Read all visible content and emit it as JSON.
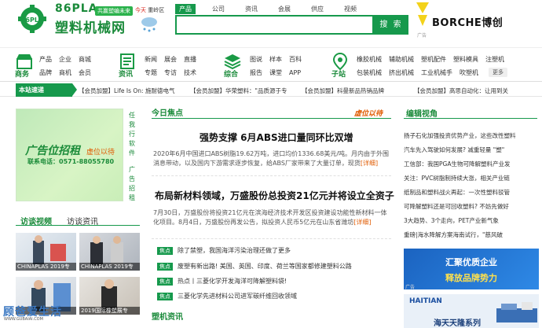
{
  "header": {
    "logo_en": "86PLA",
    "logo_slogan": "共赢塑编未来",
    "logo_cn": "塑料机械网",
    "city_label": "今天",
    "city_name": "重岭区",
    "search_tabs": [
      "产品",
      "公司",
      "资讯",
      "会展",
      "供应",
      "视频"
    ],
    "search_active": "产品",
    "search_placeholder": "",
    "search_button": "搜 索",
    "ad_brand": "BORCHE博创",
    "ad_tag": "广告"
  },
  "nav": [
    {
      "title": "商务",
      "icon": "store-icon",
      "row1": [
        "产品",
        "企业",
        "商城"
      ],
      "row2": [
        "品牌",
        "商机",
        "会员"
      ]
    },
    {
      "title": "资讯",
      "icon": "news-icon",
      "row1": [
        "新闻",
        "展会",
        "直播"
      ],
      "row2": [
        "专题",
        "专访",
        "技术"
      ]
    },
    {
      "title": "综合",
      "icon": "layers-icon",
      "row1": [
        "图说",
        "样本",
        "百科"
      ],
      "row2": [
        "报告",
        "课堂",
        "APP"
      ]
    },
    {
      "title": "子站",
      "icon": "location-icon",
      "row1": [
        "橡胶机械",
        "辅助机械",
        "塑机配件",
        "塑料模具",
        "注塑机"
      ],
      "row2": [
        "包装机械",
        "挤出机械",
        "工业机械手",
        "吹塑机"
      ]
    }
  ],
  "nav_more": "更多",
  "ticker": {
    "label": "本站速递",
    "items": [
      "【会员加盟】Life Is On: 施耐德电气",
      "【会员加盟】华荣塑料：\"品质源于专",
      "【会员加盟】科曼新品热销品牌",
      "【会员加盟】高思自动化：让用到关"
    ]
  },
  "left": {
    "ad_title": "广告位招租",
    "ad_sub": "虚位以待",
    "ad_phone": "联系电话：0571-88055780",
    "vertical_text": [
      "任",
      "我",
      "行",
      "软",
      "件"
    ],
    "vertical_hot": [
      "广",
      "告",
      "招",
      "租"
    ],
    "tabs": [
      "访谈视频",
      "访谈资讯"
    ],
    "thumbs": [
      {
        "caption": "CHINAPLAS 2019专"
      },
      {
        "caption": "CHINAPLAS 2019专"
      },
      {
        "caption": ""
      },
      {
        "caption": "2019国际橡塑展专"
      }
    ],
    "watermark": "顾爸爱生活",
    "watermark_url": "WWW.GUBAIAI.COM"
  },
  "center": {
    "section_title": "今日焦点",
    "vip_badge": "虚位以待",
    "headline1": "强势支撑 6月ABS进口量同环比双增",
    "para1_line1": "2020年6月中国进口ABS树脂19.62万吨，进口均价1336.68美元/吨。月内由于外围",
    "para1_line2": "消息带动，以及国内下游需求逐步恢复，给ABS厂家带来了大量订单，现货",
    "para1_link": "[详细]",
    "headline2": "布局新材料领域，万盛股份总投资21亿元并将设立全资子",
    "para2_line1": "7月30日，万盛股份将投资21亿元在滨海经济技术开发区投资建设功能性新材料一体",
    "para2_line2": "化项目。8月4日，万盛股份再发公告，拟投资人民币5亿元在山东省潍坊",
    "para2_link": "[详细]",
    "news_badge": "焦点",
    "news": [
      "除了禁塑，我国海洋污染治理还做了更多",
      "废塑有新出路! 美国、英国、印度、荷兰等国家都修建塑料公路",
      "热点丨三菱化学开发海洋可降解塑料袋!",
      "三菱化学先进材料公司进军碳纤维回收领域"
    ],
    "news_head": "塑机资讯"
  },
  "right": {
    "section_title": "编辑视角",
    "items": [
      "扬子石化加强投资优势产业，这些改性塑料",
      "汽车先入驾驶如何发展? 减重轻量 \"塑\"",
      "工信部：我国PGA生物可降解塑料产业发",
      "关注：PVC树脂制持续大涨，相关产业链",
      "纸制品和塑料战火再起：一次性塑料驳管",
      "可降解塑料还是可回收塑料? 不妨先做好",
      "3大趋势、3个走向，PET产业新气象",
      "重磅|海水降解方案海南试行，\"慈风破"
    ],
    "ad1_line1": "汇聚优质企业",
    "ad1_line2": "释放品牌势力",
    "ad2_logo": "HAITIAN",
    "ad2_sub": "海天天隆系列",
    "ad_tag": "广告"
  }
}
